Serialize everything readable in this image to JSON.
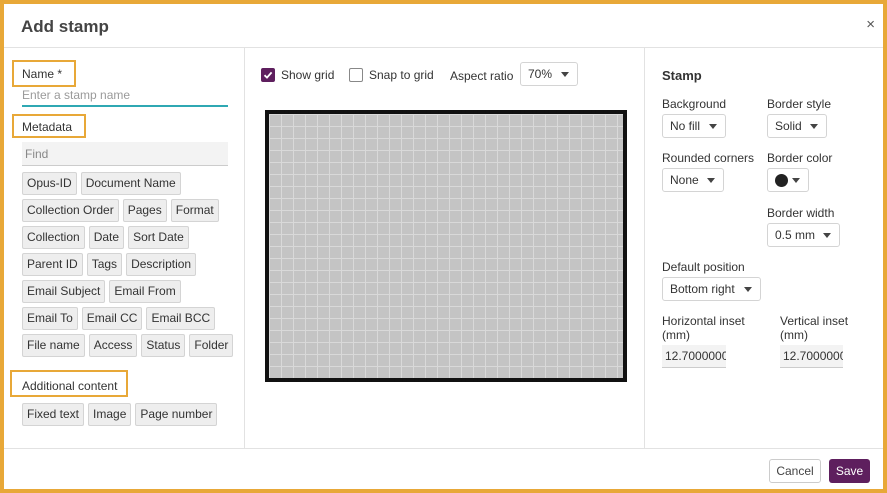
{
  "dialog": {
    "title": "Add stamp",
    "close_glyph": "×",
    "cancel_label": "Cancel",
    "save_label": "Save",
    "accent_color": "#5e1f5e"
  },
  "left": {
    "name_label": "Name *",
    "name_placeholder": "Enter a stamp name",
    "metadata_label": "Metadata",
    "find_placeholder": "Find",
    "metadata_rows": [
      [
        "Opus-ID",
        "Document Name"
      ],
      [
        "Collection Order",
        "Pages",
        "Format"
      ],
      [
        "Collection",
        "Date",
        "Sort Date"
      ],
      [
        "Parent ID",
        "Tags",
        "Description"
      ],
      [
        "Email Subject",
        "Email From"
      ],
      [
        "Email To",
        "Email CC",
        "Email BCC"
      ],
      [
        "File name",
        "Access",
        "Status",
        "Folder"
      ]
    ],
    "additional_label": "Additional content",
    "additional_items": [
      "Fixed text",
      "Image",
      "Page number"
    ]
  },
  "middle": {
    "show_grid_label": "Show grid",
    "show_grid_checked": true,
    "snap_label": "Snap to grid",
    "snap_checked": false,
    "aspect_label": "Aspect ratio",
    "aspect_value": "70%"
  },
  "right": {
    "title": "Stamp",
    "background_label": "Background",
    "background_value": "No fill",
    "border_style_label": "Border style",
    "border_style_value": "Solid",
    "rounded_label": "Rounded corners",
    "rounded_value": "None",
    "border_color_label": "Border color",
    "border_color": "#222222",
    "border_width_label": "Border width",
    "border_width_value": "0.5 mm",
    "default_position_label": "Default position",
    "default_position_value": "Bottom right",
    "horizontal_inset_label": "Horizontal inset",
    "vertical_inset_label": "Vertical inset",
    "inset_unit": "(mm)",
    "horizontal_inset_value": "12.7000000",
    "vertical_inset_value": "12.7000000"
  }
}
